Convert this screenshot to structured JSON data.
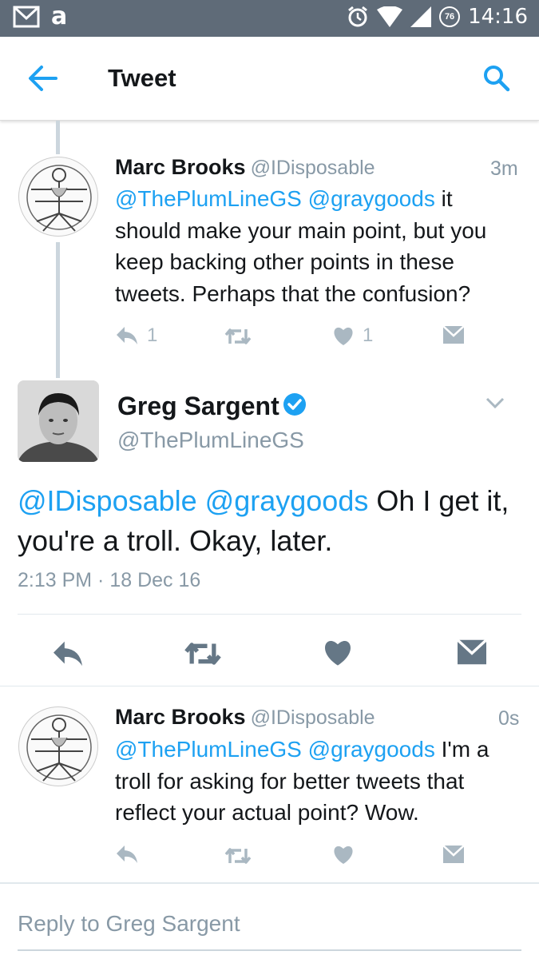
{
  "status_bar": {
    "time": "14:16",
    "battery": "76",
    "icons": [
      "gmail-icon",
      "amazon-icon",
      "alarm-icon",
      "wifi-icon",
      "signal-icon",
      "battery-icon"
    ],
    "amazon_glyph": "a"
  },
  "app_bar": {
    "title": "Tweet",
    "accent": "#1da1f2"
  },
  "tweets": [
    {
      "name": "Marc Brooks",
      "handle": "@IDisposable",
      "time": "3m",
      "mention1": "@ThePlumLineGS",
      "mention2": "@graygoods",
      "text_line1_rest": " it",
      "text_line2": "should make your main point, but you",
      "text_line3": "keep backing other points in these",
      "text_line4": "tweets. Perhaps that the confusion?",
      "reply_count": "1",
      "like_count": "1"
    },
    {
      "name": "Marc Brooks",
      "handle": "@IDisposable",
      "time": "0s",
      "mention1": "@ThePlumLineGS",
      "mention2": "@graygoods",
      "text_line1_rest": " I'm a",
      "text_line2": "troll for asking for better tweets that",
      "text_line3": "reflect your actual point? Wow."
    }
  ],
  "main_tweet": {
    "name": "Greg Sargent",
    "handle": "@ThePlumLineGS",
    "mention1": "@IDisposable",
    "mention2": "@graygoods",
    "text_line1_rest": " Oh I get it,",
    "text_line2": "you're a troll. Okay, later.",
    "timestamp": "2:13 PM · 18 Dec 16"
  },
  "reply_box": {
    "placeholder": "Reply to Greg Sargent"
  }
}
